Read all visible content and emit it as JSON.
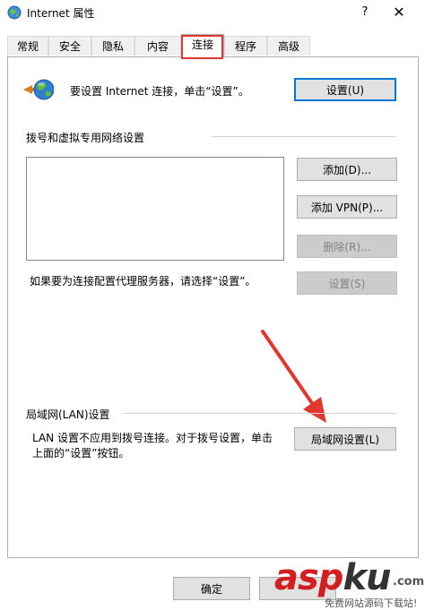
{
  "window": {
    "title": "Internet 属性",
    "help_glyph": "?",
    "close_glyph": "✕"
  },
  "tabs": [
    {
      "label": "常规",
      "active": false
    },
    {
      "label": "安全",
      "active": false
    },
    {
      "label": "隐私",
      "active": false
    },
    {
      "label": "内容",
      "active": false
    },
    {
      "label": "连接",
      "active": true
    },
    {
      "label": "程序",
      "active": false
    },
    {
      "label": "高级",
      "active": false
    }
  ],
  "setup": {
    "text": "要设置 Internet 连接，单击“设置”。",
    "button": "设置(U)"
  },
  "dialup": {
    "group_label": "拨号和虚拟专用网络设置",
    "add_button": "添加(D)...",
    "add_vpn_button": "添加 VPN(P)...",
    "delete_button": "删除(R)...",
    "proxy_text": "如果要为连接配置代理服务器，请选择“设置”。",
    "settings_button": "设置(S)"
  },
  "lan": {
    "group_label": "局域网(LAN)设置",
    "text_line1": "LAN 设置不应用到拨号连接。对于拨号设置，单击",
    "text_line2": "上面的“设置”按钮。",
    "button": "局域网设置(L)"
  },
  "footer": {
    "ok_button": "确定"
  },
  "watermark": {
    "brand_main": "asp",
    "brand_accent": "ku",
    "brand_tld": ".com",
    "subtitle": "免费网站源码下载站!"
  },
  "colors": {
    "highlight_red": "#e2362e",
    "default_button_border": "#0078d7"
  }
}
